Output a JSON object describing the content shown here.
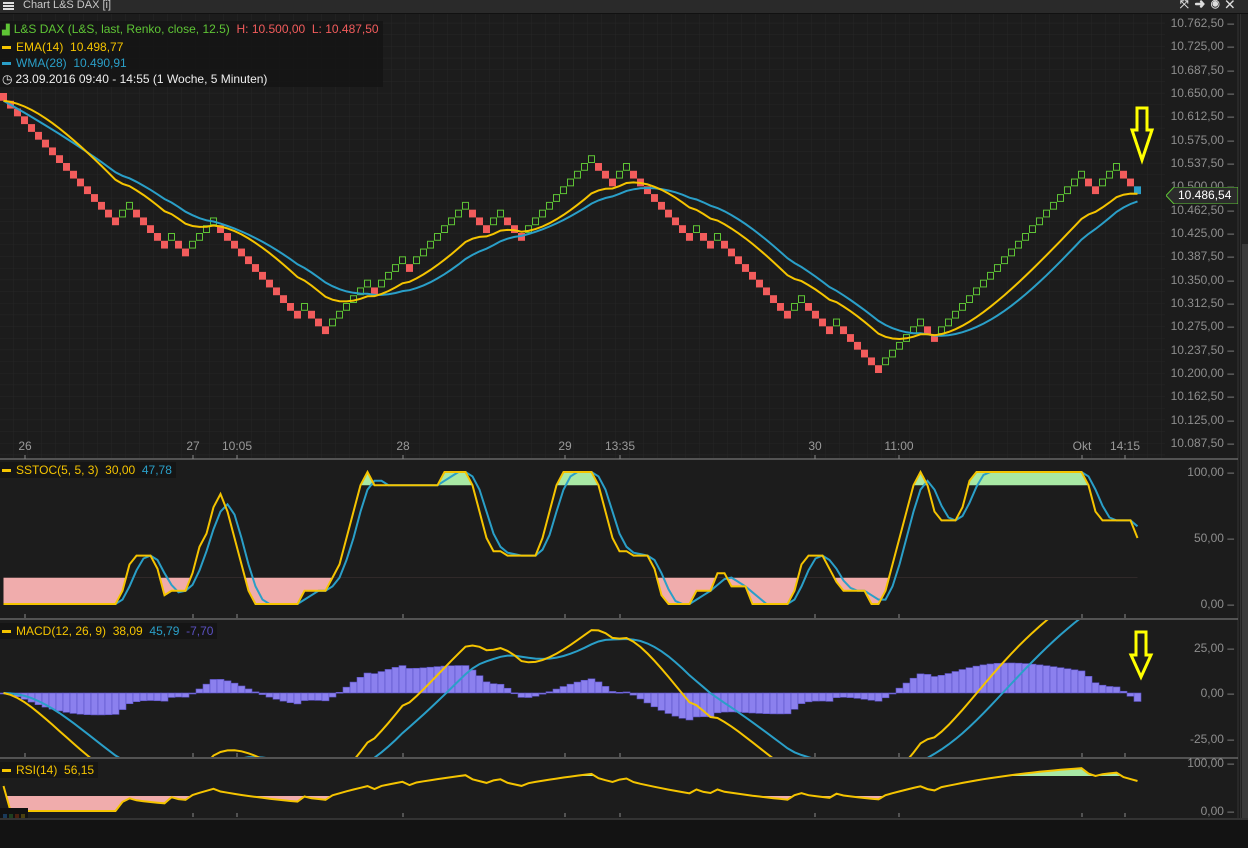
{
  "window": {
    "title": "Chart L&S DAX [i]",
    "icons": [
      "maximize-icon",
      "export-icon",
      "settings-icon",
      "close-icon"
    ]
  },
  "main": {
    "instrument": "L&S DAX (L&S, last, Renko, close, 12.5)",
    "high": "H: 10.500,00",
    "low": "L: 10.487,50",
    "ema_label": "EMA(14)",
    "ema_value": "10.498,77",
    "wma_label": "WMA(28)",
    "wma_value": "10.490,91",
    "range": "23.09.2016 09:40 - 14:55 (1 Woche, 5 Minuten)",
    "last_price": "10.486,54",
    "y_labels": [
      "10.762,50",
      "10.725,00",
      "10.687,50",
      "10.650,00",
      "10.612,50",
      "10.575,00",
      "10.537,50",
      "10.500,00",
      "10.462,50",
      "10.425,00",
      "10.387,50",
      "10.350,00",
      "10.312,50",
      "10.275,00",
      "10.237,50",
      "10.200,00",
      "10.162,50",
      "10.125,00",
      "10.087,50"
    ],
    "time_labels": [
      "26",
      "27",
      "10:05",
      "28",
      "29",
      "13:35",
      "30",
      "11:00",
      "Okt",
      "14:15"
    ]
  },
  "sstoc": {
    "label": "SSTOC(5, 5, 3)",
    "k": "30,00",
    "d": "47,78",
    "y_labels": [
      "100,00",
      "50,00",
      "0,00"
    ]
  },
  "macd": {
    "label": "MACD(12, 26, 9)",
    "macd": "38,09",
    "signal": "45,79",
    "hist": "-7,70",
    "y_labels": [
      "25,00",
      "0,00",
      "-25,00"
    ]
  },
  "rsi": {
    "label": "RSI(14)",
    "value": "56,15",
    "y_labels": [
      "100,00",
      "0,00"
    ]
  },
  "colors": {
    "up": "#5ec435",
    "down": "#f25c5c",
    "ema": "#f5c400",
    "wma": "#2a9fc8",
    "hist": "#8b80ee",
    "overbought": "#a8e8a4",
    "oversold": "#f0acac",
    "arrow": "#ffff00"
  },
  "chart_data": {
    "type": "renko",
    "brick_size": 12.5,
    "start_price": 10650,
    "runs": [
      -17,
      2,
      -5,
      1,
      -2,
      4,
      -12,
      1,
      -3,
      6,
      -1,
      4,
      -1,
      8,
      -3,
      2,
      -3,
      10,
      -3,
      2,
      -9,
      1,
      -2,
      1,
      -10,
      2,
      -4,
      1,
      -6,
      6,
      -2,
      21,
      -2,
      3,
      -3
    ],
    "price_range": [
      10087.5,
      10762.5
    ],
    "indicators": [
      "EMA(14)",
      "WMA(28)",
      "SSTOC(5,5,3)",
      "MACD(12,26,9)",
      "RSI(14)"
    ]
  }
}
